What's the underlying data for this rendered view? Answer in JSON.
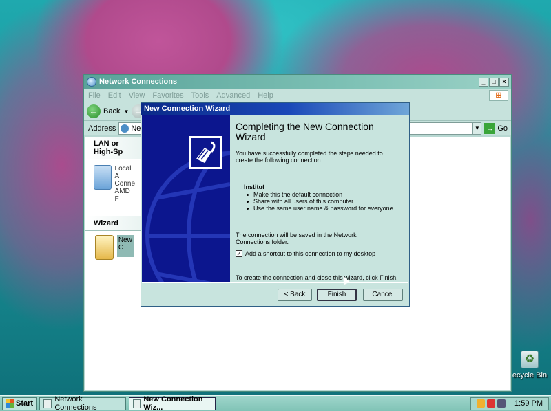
{
  "desktop": {
    "recycle_bin_label": "ecycle Bin"
  },
  "explorer": {
    "title": "Network Connections",
    "menu": [
      "File",
      "Edit",
      "View",
      "Favorites",
      "Tools",
      "Advanced",
      "Help"
    ],
    "back_label": "Back",
    "address_label": "Address",
    "address_value": "Netwo",
    "go_label": "Go",
    "group_lan": "LAN or High-Sp",
    "local_conn": [
      "Local A",
      "Conne",
      "AMD F"
    ],
    "group_wizard": "Wizard",
    "wizard_item": "New C"
  },
  "wizard": {
    "title": "New Connection Wizard",
    "heading": "Completing the New Connection Wizard",
    "intro": "You have successfully completed the steps needed to create the following connection:",
    "connection_name": "Institut",
    "bullets": [
      "Make this the default connection",
      "Share with all users of this computer",
      "Use the same user name & password for everyone"
    ],
    "saved_note": "The connection will be saved in the Network Connections folder.",
    "shortcut_label": "Add a shortcut to this connection to my desktop",
    "shortcut_checked": true,
    "finish_note": "To create the connection and close this wizard, click Finish.",
    "back_button": "< Back",
    "finish_button": "Finish",
    "cancel_button": "Cancel"
  },
  "taskbar": {
    "start_label": "Start",
    "tasks": [
      "Network Connections",
      "New Connection Wiz..."
    ],
    "time": "1:59 PM"
  }
}
